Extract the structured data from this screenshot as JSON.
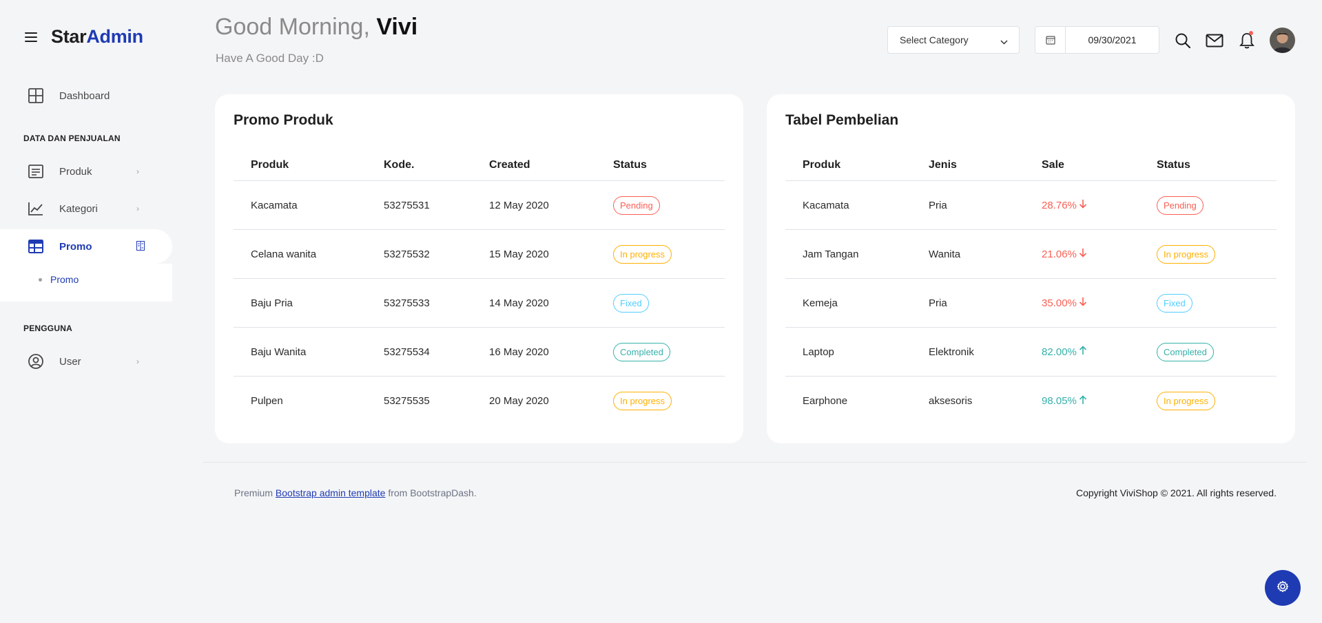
{
  "brand": {
    "part1": "Star",
    "part2": "Admin"
  },
  "sidebar": {
    "dashboard": "Dashboard",
    "section1": "DATA DAN PENJUALAN",
    "produk": "Produk",
    "kategori": "Kategori",
    "promo": "Promo",
    "promo_sub": "Promo",
    "section2": "PENGGUNA",
    "user": "User"
  },
  "header": {
    "greeting": "Good Morning,",
    "name": "Vivi",
    "subtitle": "Have A Good Day :D",
    "category_placeholder": "Select Category",
    "date": "09/30/2021"
  },
  "promo_card": {
    "title": "Promo Produk",
    "headers": [
      "Produk",
      "Kode.",
      "Created",
      "Status"
    ],
    "rows": [
      {
        "produk": "Kacamata",
        "kode": "53275531",
        "created": "12 May 2020",
        "status": "Pending"
      },
      {
        "produk": "Celana wanita",
        "kode": "53275532",
        "created": "15 May 2020",
        "status": "In progress"
      },
      {
        "produk": "Baju Pria",
        "kode": "53275533",
        "created": "14 May 2020",
        "status": "Fixed"
      },
      {
        "produk": "Baju Wanita",
        "kode": "53275534",
        "created": "16 May 2020",
        "status": "Completed"
      },
      {
        "produk": "Pulpen",
        "kode": "53275535",
        "created": "20 May 2020",
        "status": "In progress"
      }
    ]
  },
  "purchase_card": {
    "title": "Tabel Pembelian",
    "headers": [
      "Produk",
      "Jenis",
      "Sale",
      "Status"
    ],
    "rows": [
      {
        "produk": "Kacamata",
        "jenis": "Pria",
        "sale": "28.76%",
        "trend": "down",
        "status": "Pending"
      },
      {
        "produk": "Jam Tangan",
        "jenis": "Wanita",
        "sale": "21.06%",
        "trend": "down",
        "status": "In progress"
      },
      {
        "produk": "Kemeja",
        "jenis": "Pria",
        "sale": "35.00%",
        "trend": "down",
        "status": "Fixed"
      },
      {
        "produk": "Laptop",
        "jenis": "Elektronik",
        "sale": "82.00%",
        "trend": "up",
        "status": "Completed"
      },
      {
        "produk": "Earphone",
        "jenis": "aksesoris",
        "sale": "98.05%",
        "trend": "up",
        "status": "In progress"
      }
    ]
  },
  "status_colors": {
    "Pending": "#f95f53",
    "In progress": "#ffaf00",
    "Fixed": "#52cdff",
    "Completed": "#34b1aa"
  },
  "trend_colors": {
    "down": "#f95f53",
    "up": "#34b1aa"
  },
  "footer": {
    "prefix": "Premium ",
    "link": "Bootstrap admin template",
    "suffix": " from BootstrapDash.",
    "copyright": "Copyright ViviShop © 2021. All rights reserved."
  },
  "colors": {
    "accent": "#1f3bb3",
    "background": "#f4f5f7"
  }
}
